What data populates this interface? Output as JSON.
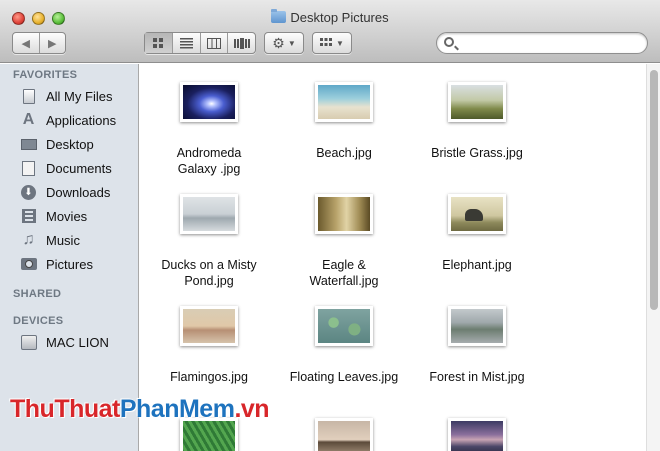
{
  "window": {
    "title": "Desktop Pictures"
  },
  "toolbar": {
    "back_icon": "◀",
    "forward_icon": "▶",
    "view_modes": [
      "icon-view",
      "list-view",
      "column-view",
      "coverflow-view"
    ],
    "active_view": "icon-view",
    "search_placeholder": ""
  },
  "sidebar": {
    "favorites_header": "FAVORITES",
    "favorites": [
      {
        "label": "All My Files",
        "icon": "all-files-icon"
      },
      {
        "label": "Applications",
        "icon": "applications-icon"
      },
      {
        "label": "Desktop",
        "icon": "desktop-icon"
      },
      {
        "label": "Documents",
        "icon": "documents-icon"
      },
      {
        "label": "Downloads",
        "icon": "downloads-icon"
      },
      {
        "label": "Movies",
        "icon": "movies-icon"
      },
      {
        "label": "Music",
        "icon": "music-icon"
      },
      {
        "label": "Pictures",
        "icon": "pictures-icon"
      }
    ],
    "shared_header": "SHARED",
    "devices_header": "DEVICES",
    "devices": [
      {
        "label": "MAC LION",
        "icon": "disk-icon"
      }
    ]
  },
  "files": [
    {
      "name": "Andromeda Galaxy .jpg"
    },
    {
      "name": "Beach.jpg"
    },
    {
      "name": "Bristle Grass.jpg"
    },
    {
      "name": "Ducks on a Misty Pond.jpg"
    },
    {
      "name": "Eagle & Waterfall.jpg"
    },
    {
      "name": "Elephant.jpg"
    },
    {
      "name": "Flamingos.jpg"
    },
    {
      "name": "Floating Leaves.jpg"
    },
    {
      "name": "Forest in Mist.jpg"
    }
  ],
  "watermark": {
    "part1": "ThuThuat",
    "part2": "PhanMem",
    "part3": ".vn"
  }
}
